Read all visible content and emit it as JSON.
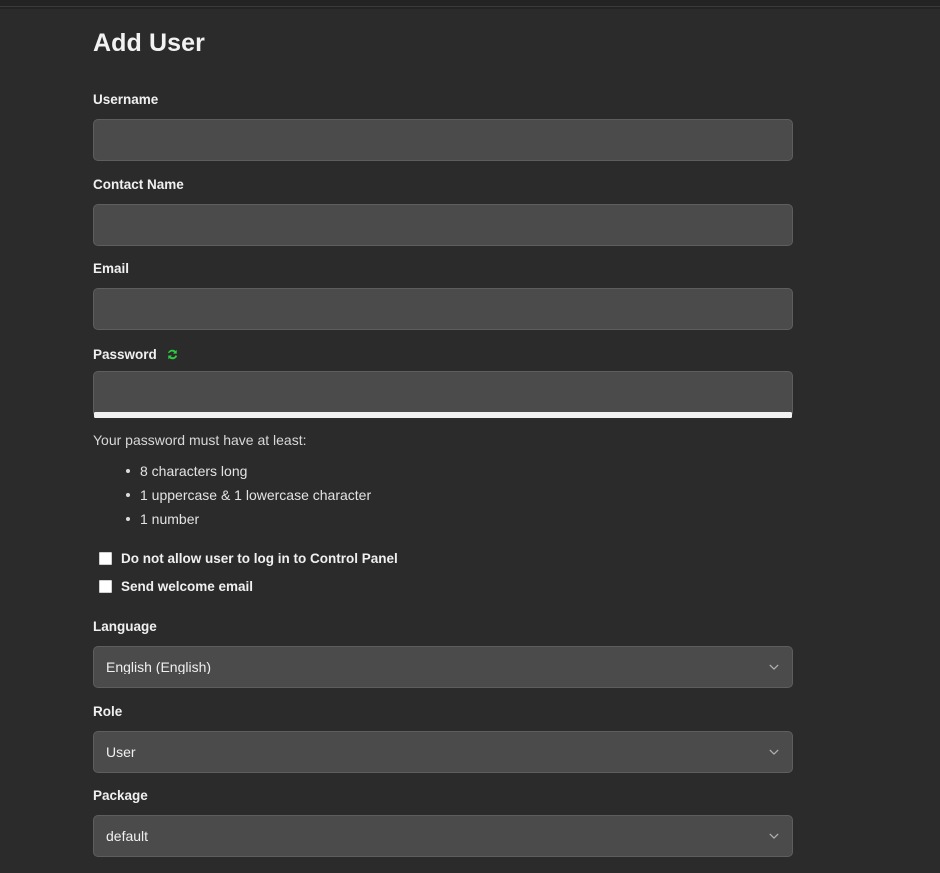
{
  "page": {
    "title": "Add User",
    "background_color": "#2b2b2b",
    "accent_green": "#2ecc40"
  },
  "form": {
    "username": {
      "label": "Username",
      "value": "",
      "placeholder": ""
    },
    "contact_name": {
      "label": "Contact Name",
      "value": "",
      "placeholder": ""
    },
    "email": {
      "label": "Email",
      "value": "",
      "placeholder": ""
    },
    "password": {
      "label": "Password",
      "value": "",
      "placeholder": "",
      "generate_icon": "refresh-icon",
      "strength_percent": 100,
      "hint": "Your password must have at least:",
      "rules": [
        "8 characters long",
        "1 uppercase & 1 lowercase character",
        "1 number"
      ]
    },
    "checkboxes": [
      {
        "label": "Do not allow user to log in to Control Panel",
        "checked": false
      },
      {
        "label": "Send welcome email",
        "checked": false
      }
    ],
    "language": {
      "label": "Language",
      "value": "English (English)",
      "icon": "chevron-down-icon"
    },
    "role": {
      "label": "Role",
      "value": "User",
      "icon": "chevron-down-icon"
    },
    "package": {
      "label": "Package",
      "value": "default",
      "icon": "chevron-down-icon"
    }
  }
}
